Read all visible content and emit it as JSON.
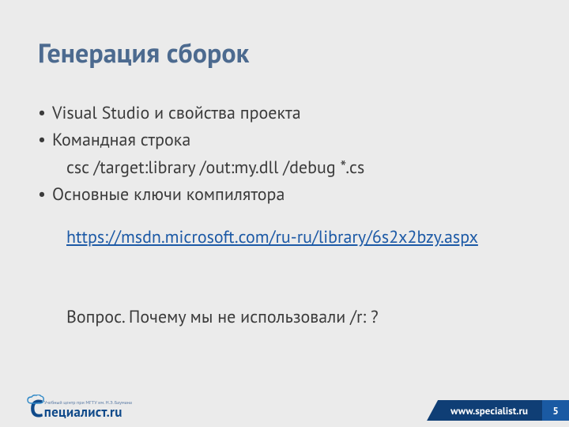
{
  "title": "Генерация сборок",
  "bullets": {
    "b1": "Visual Studio и свойства проекта",
    "b2": "Командная строка",
    "cmd": "csc  /target:library  /out:my.dll  /debug  *.cs",
    "b3": "Основные ключи компилятора",
    "link": "https://msdn.microsoft.com/ru-ru/library/6s2x2bzy.aspx",
    "question": "Вопрос.   Почему мы не использовали /r: ?"
  },
  "footer": {
    "logo_sub": "Учебный центр при МГТУ им. Н.Э. Баумана",
    "logo_c": "С",
    "logo_main": "пециалист",
    "logo_suffix": ".ru",
    "site": "www.specialist.ru",
    "page": "5"
  }
}
